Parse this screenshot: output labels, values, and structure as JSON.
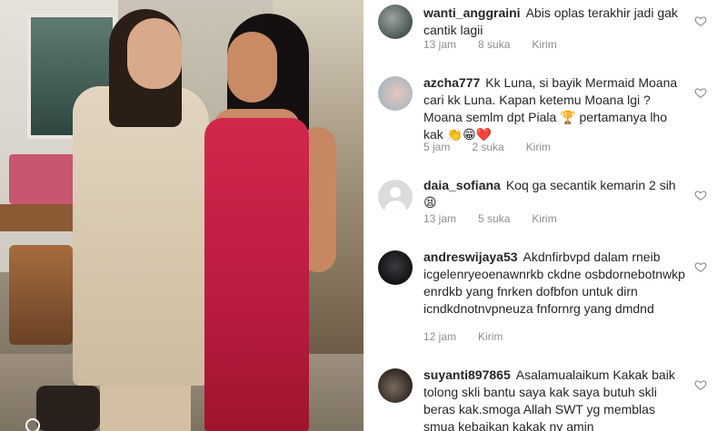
{
  "comments": [
    {
      "username": "wanti_anggraini",
      "text": "Abis oplas terakhir jadi gak cantik lagii",
      "time": "13 jam",
      "likes": "8 suka",
      "reply": "Kirim"
    },
    {
      "username": "azcha777",
      "text": "Kk Luna, si bayik Mermaid Moana cari kk Luna. Kapan ketemu Moana lgi ? Moana semlm dpt Piala 🏆 pertamanya lho kak 👏😁❤️",
      "time": "5 jam",
      "likes": "2 suka",
      "reply": "Kirim"
    },
    {
      "username": "daia_sofiana",
      "text": "Koq ga secantik kemarin 2 sih😫",
      "time": "13 jam",
      "likes": "5 suka",
      "reply": "Kirim"
    },
    {
      "username": "andreswijaya53",
      "text": "Akdnfirbvpd dalam rneib icgelenryeoenawnrkb ckdne osbdornebotnwkp enrdkb yang fnrken dofbfon untuk dirn icndkdnotnvpneuza fnfornrg yang dmdnd",
      "time": "12 jam",
      "likes": "",
      "reply": "Kirim"
    },
    {
      "username": "suyanti897865",
      "text": "Asalamualaikum Kakak baik tolong skli bantu saya kak saya butuh skli beras kak.smoga Allah SWT yg memblas smua kebaikan kakak ny amin",
      "time": "",
      "likes": "",
      "reply": ""
    }
  ],
  "icons": {
    "like": "heart-outline-icon"
  },
  "colors": {
    "text": "#262626",
    "meta": "#8e8e8e",
    "dress": "#c8224a"
  }
}
